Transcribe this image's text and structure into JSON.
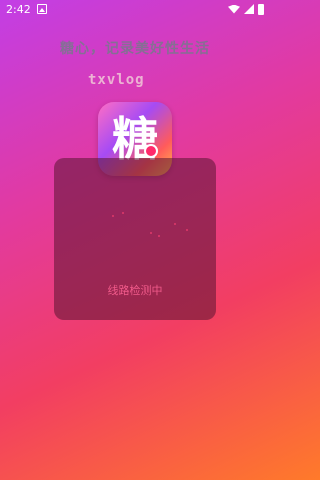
{
  "status_bar": {
    "time": "2:42"
  },
  "app": {
    "logo_char": "糖",
    "slogan": "糖心，记录美好性生活",
    "brand": "txvlog"
  },
  "dialog": {
    "status_text": "线路检测中"
  }
}
